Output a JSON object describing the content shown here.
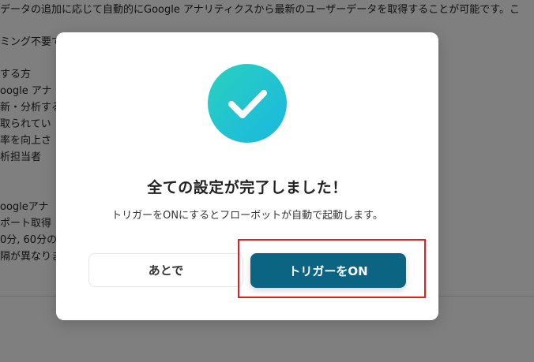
{
  "background": {
    "lines": [
      "データの追加に応じて自動的にGoogle アナリティクスから最新のユーザーデータを取得することが可能です。こ",
      "ミング不要で",
      "する方",
      "oogle アナ",
      "新・分析する",
      "取られてい",
      "率を向上さ",
      "析担当者",
      "oogleアナ",
      "ポート取得",
      "0分, 60分の",
      "隔が異なりま"
    ]
  },
  "modal": {
    "icon": "check-icon",
    "title": "全ての設定が完了しました！",
    "message": "トリガーをONにするとフローボットが自動で起動します。",
    "later_label": "あとで",
    "on_label": "トリガーをON"
  },
  "colors": {
    "overlay": "#000000",
    "primary_button": "#0a6482",
    "check_gradient_start": "#2ad0bf",
    "check_gradient_end": "#19b8e0",
    "highlight": "#e02020"
  }
}
